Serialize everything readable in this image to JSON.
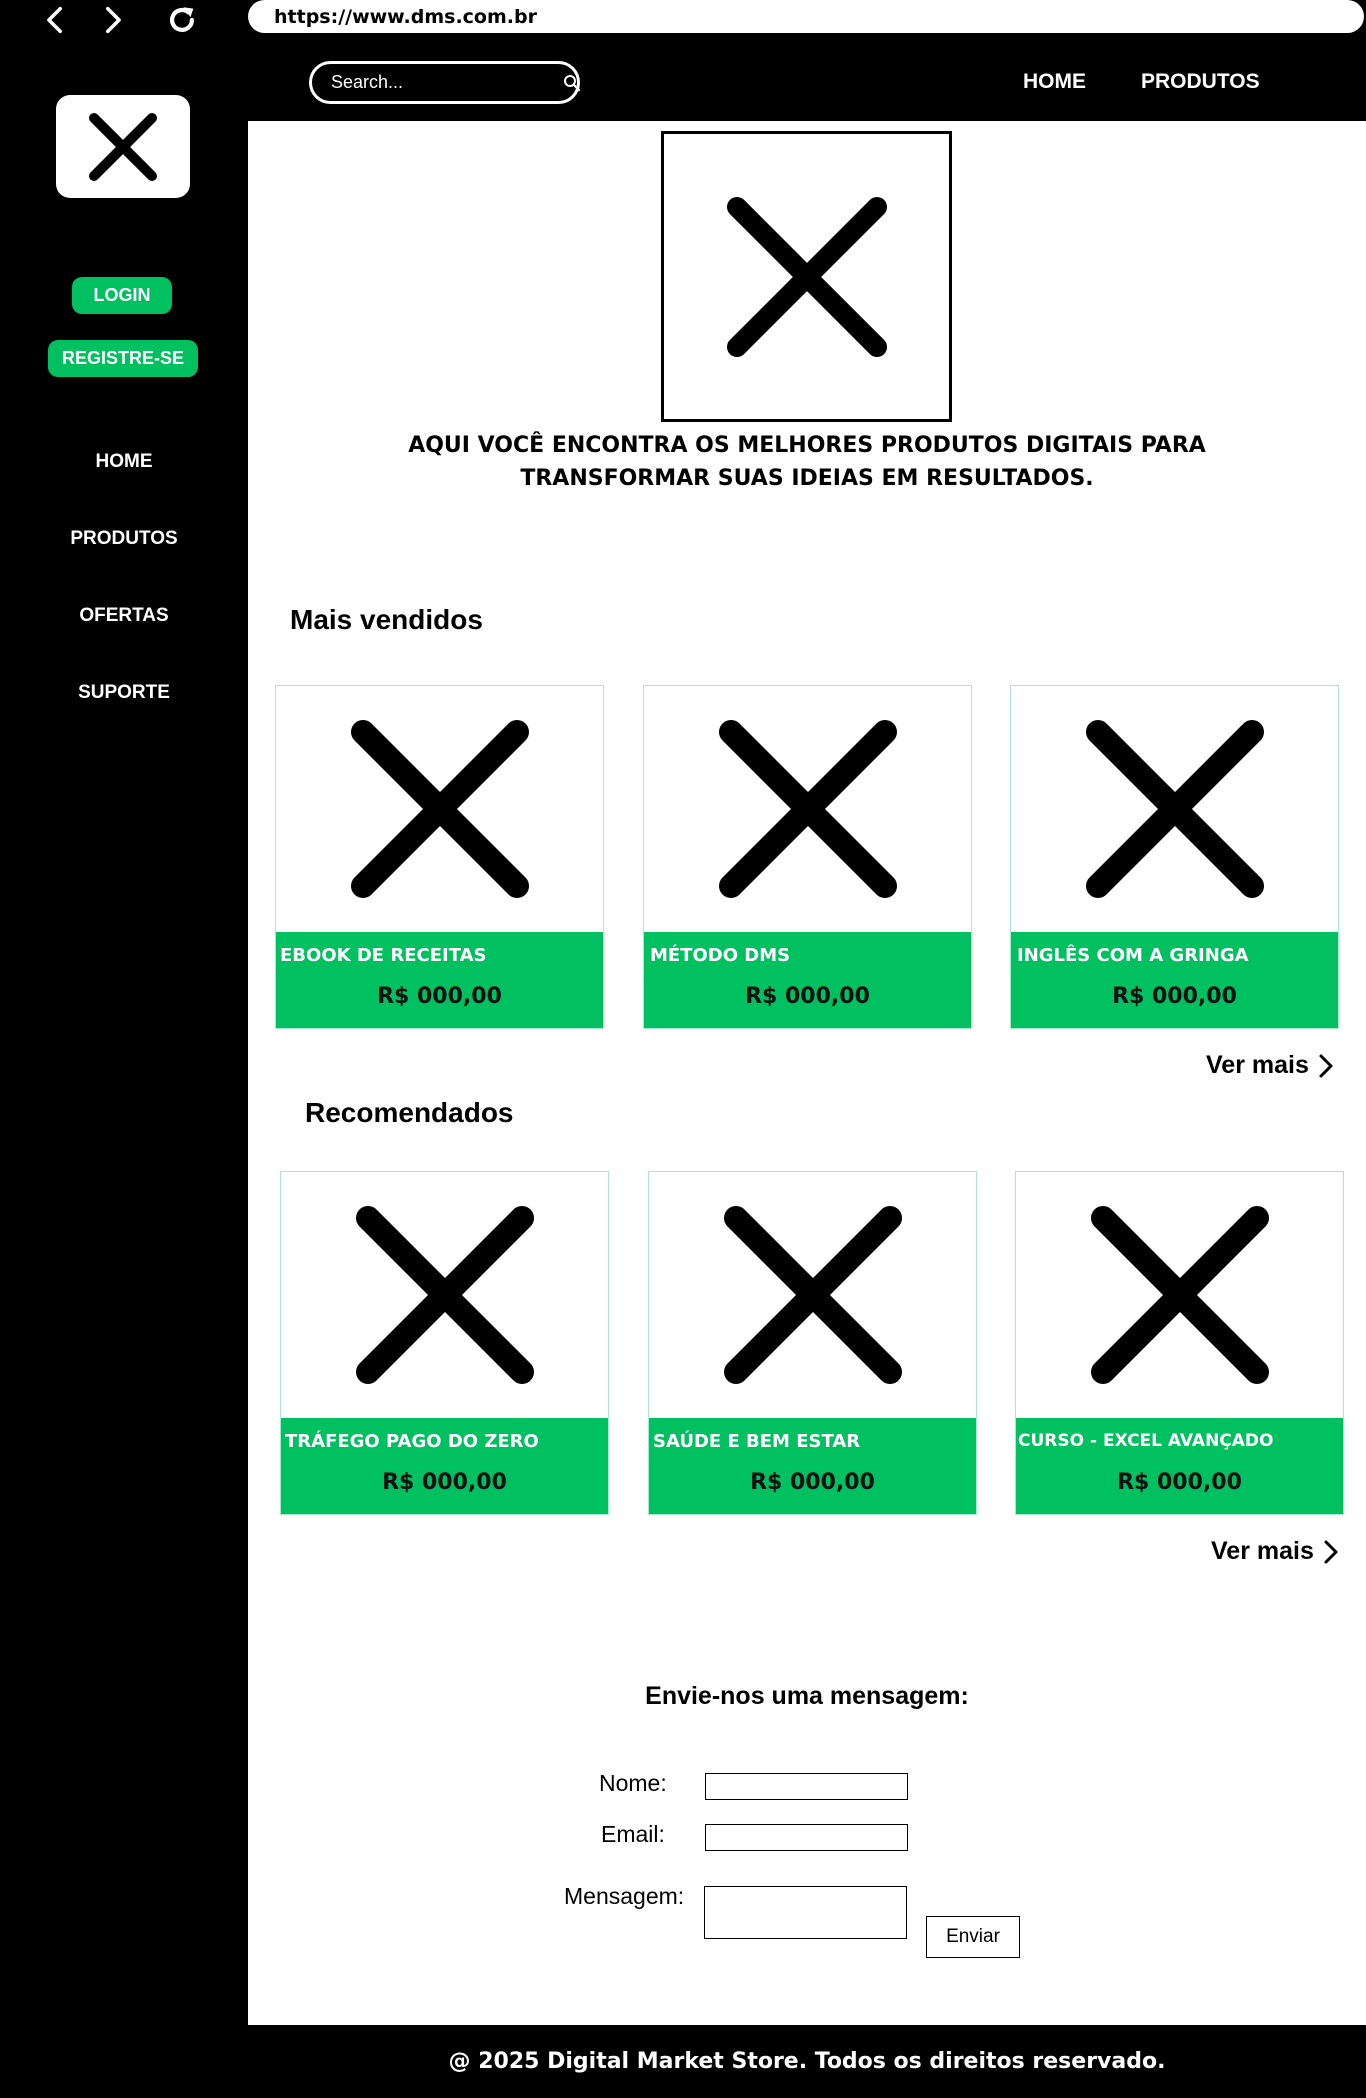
{
  "browser": {
    "url": "https://www.dms.com.br",
    "icons": [
      "back-icon",
      "forward-icon",
      "reload-icon"
    ]
  },
  "sidebar": {
    "logo_icon": "x-placeholder-icon",
    "login_label": "LOGIN",
    "register_label": "REGISTRE-SE",
    "links": [
      "HOME",
      "PRODUTOS",
      "OFERTAS",
      "SUPORTE"
    ]
  },
  "header": {
    "search_placeholder": "Search...",
    "search_icon": "search-icon",
    "links": [
      "HOME",
      "PRODUTOS"
    ]
  },
  "hero": {
    "image_icon": "x-placeholder-icon",
    "line1": "AQUI VOCÊ ENCONTRA OS MELHORES PRODUTOS DIGITAIS PARA",
    "line2": "TRANSFORMAR SUAS IDEIAS EM RESULTADOS."
  },
  "best_sellers": {
    "title": "Mais vendidos",
    "products": [
      {
        "name": "EBOOK DE RECEITAS",
        "price": "R$ 000,00"
      },
      {
        "name": "MÉTODO DMS",
        "price": "R$ 000,00"
      },
      {
        "name": "INGLÊS COM A GRINGA",
        "price": "R$ 000,00"
      }
    ],
    "see_more": "Ver mais"
  },
  "recommended": {
    "title": "Recomendados",
    "products": [
      {
        "name": "TRÁFEGO PAGO DO ZERO",
        "price": "R$ 000,00"
      },
      {
        "name": "SAÚDE E BEM ESTAR",
        "price": "R$ 000,00"
      },
      {
        "name": "CURSO - EXCEL AVANÇADO",
        "price": "R$ 000,00"
      }
    ],
    "see_more": "Ver mais"
  },
  "contact": {
    "title": "Envie-nos uma mensagem:",
    "name_label": "Nome:",
    "email_label": "Email:",
    "message_label": "Mensagem:",
    "name_value": "",
    "email_value": "",
    "message_value": "",
    "send_label": "Enviar"
  },
  "footer": {
    "text": "@ 2025 Digital Market Store. Todos os direitos reservado."
  },
  "colors": {
    "accent_green": "#00c060",
    "background_dark": "#000000"
  }
}
